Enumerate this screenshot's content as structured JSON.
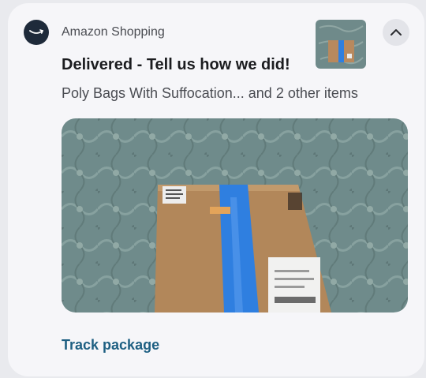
{
  "notification": {
    "app_name": "Amazon Shopping",
    "app_icon": "amazon-smile-icon",
    "title": "Delivered - Tell us how we did!",
    "subtitle": "Poly Bags With Suffocation... and 2 other items",
    "action_label": "Track package",
    "collapse_icon": "chevron-up-icon"
  },
  "colors": {
    "card_bg": "#f6f6f9",
    "action_text": "#1d5f82",
    "app_icon_bg": "#1e2a3a",
    "box_tape": "#2f7fe0"
  }
}
